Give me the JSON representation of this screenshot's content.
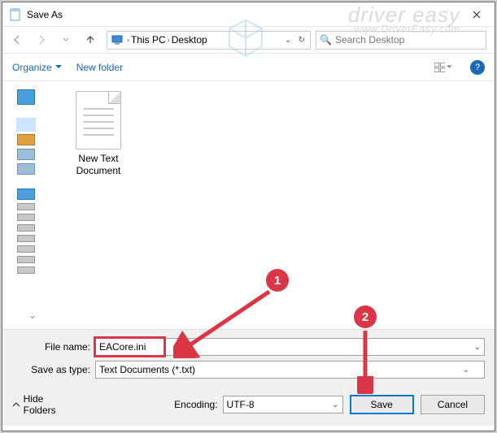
{
  "titlebar": {
    "title": "Save As"
  },
  "nav": {
    "breadcrumb": [
      "This PC",
      "Desktop"
    ],
    "search_placeholder": "Search Desktop"
  },
  "toolbar": {
    "organize": "Organize",
    "new_folder": "New folder"
  },
  "content": {
    "files": [
      {
        "name": "New Text Document"
      }
    ]
  },
  "fields": {
    "filename_label": "File name:",
    "filename_value": "EACore.ini",
    "type_label": "Save as type:",
    "type_value": "Text Documents (*.txt)"
  },
  "bottom": {
    "hide_folders": "Hide Folders",
    "encoding_label": "Encoding:",
    "encoding_value": "UTF-8",
    "save": "Save",
    "cancel": "Cancel"
  },
  "annotations": {
    "marker1": "1",
    "marker2": "2"
  },
  "watermark": {
    "line1": "driver easy",
    "line2": "www.DriverEasy.com"
  }
}
